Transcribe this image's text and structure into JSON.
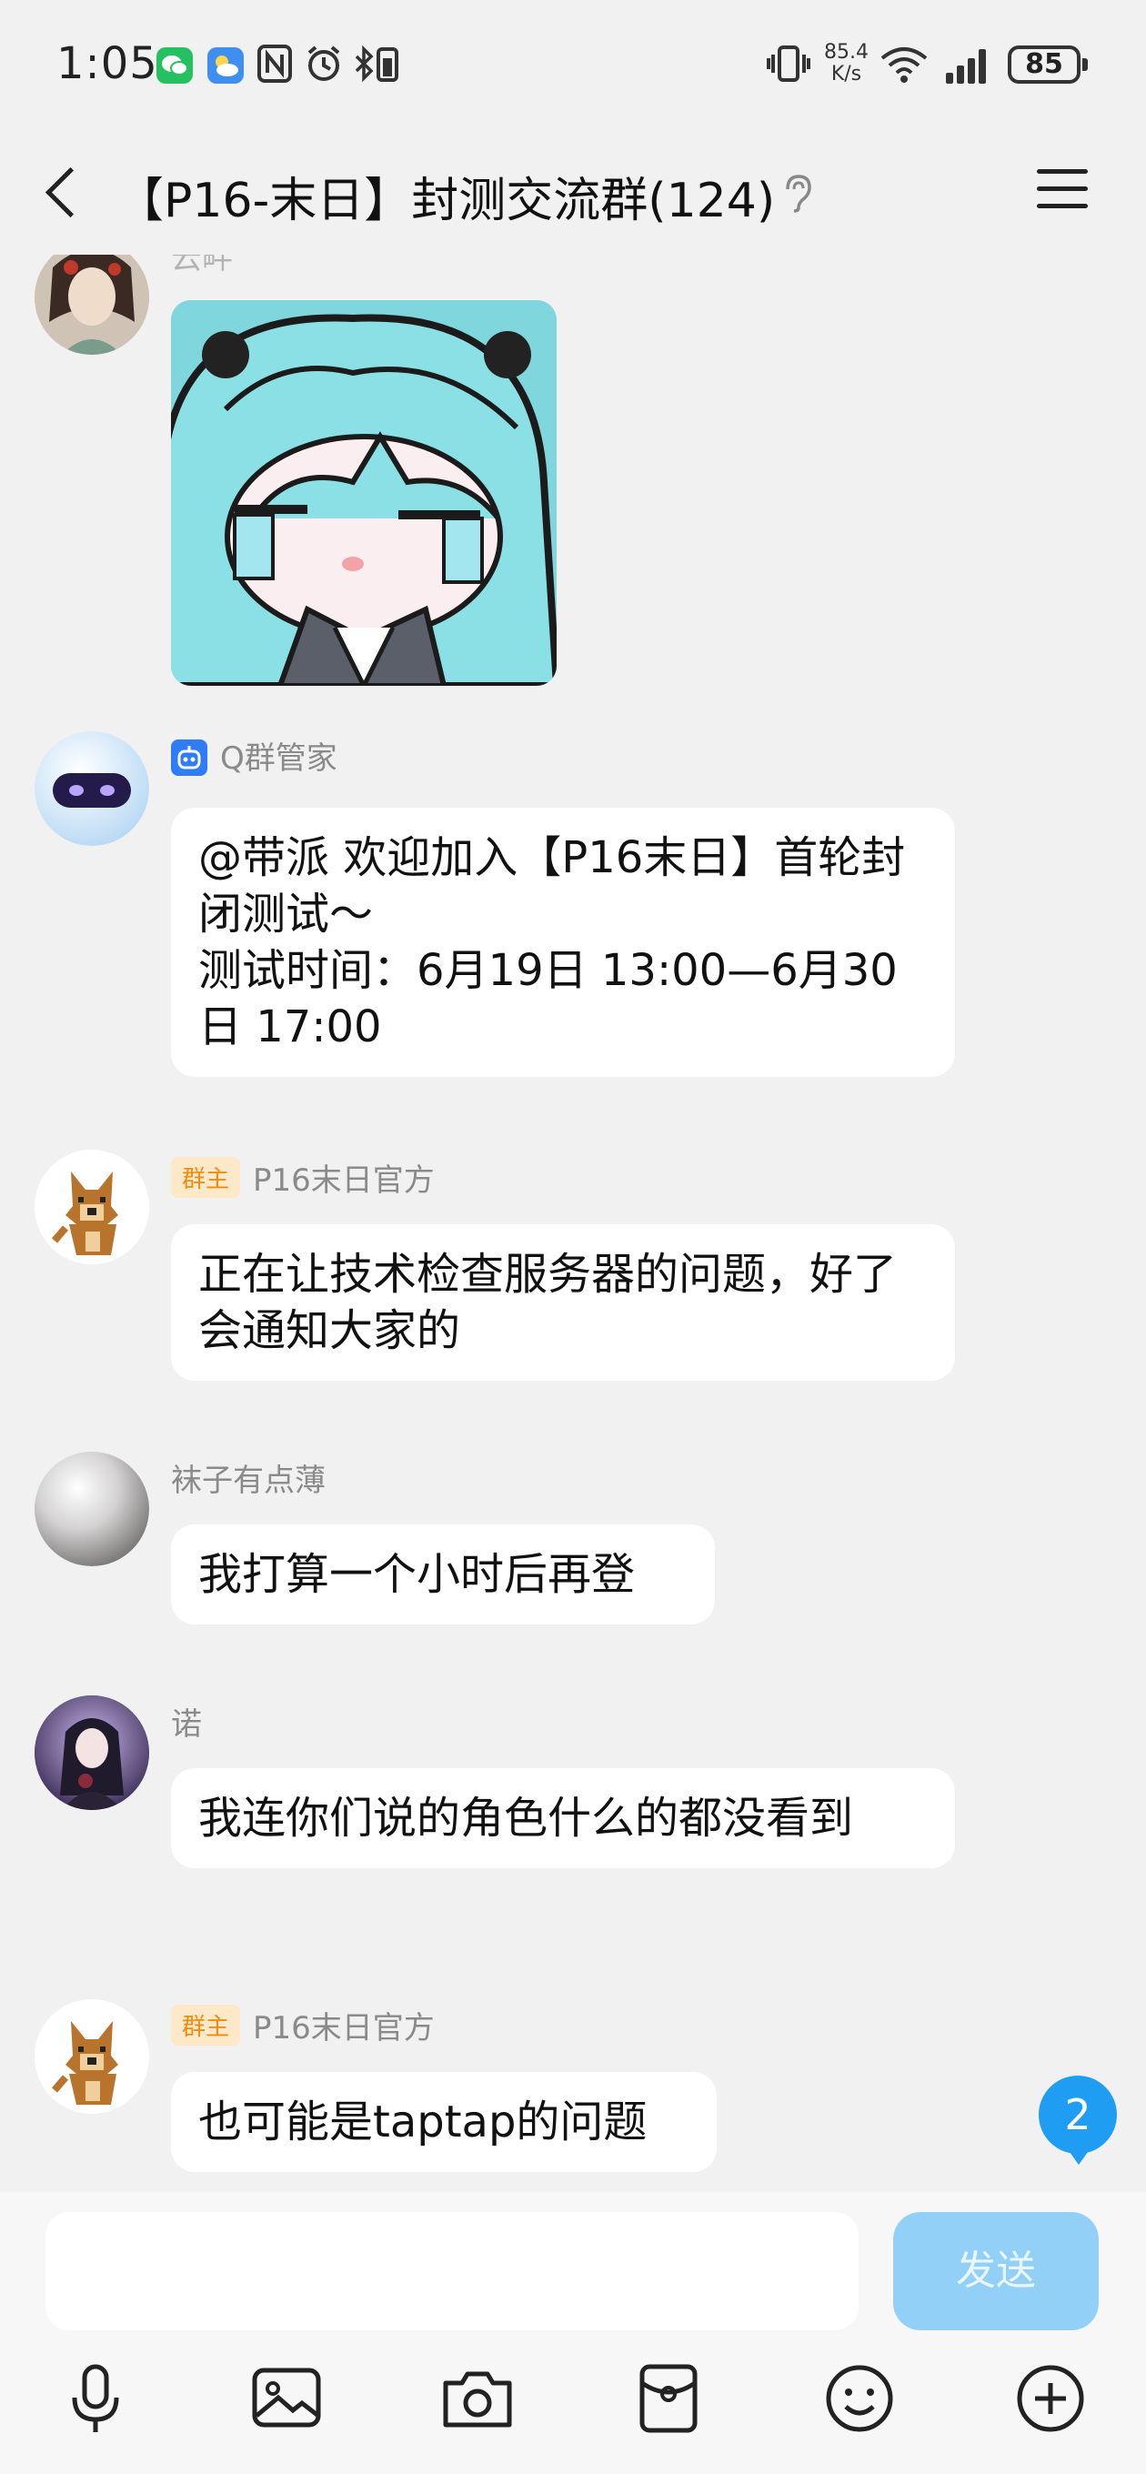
{
  "status_bar": {
    "time": "1:05",
    "net_speed_value": "85.4",
    "net_speed_unit": "K/s",
    "battery": "85"
  },
  "header": {
    "title": "【P16-末日】封测交流群(124)"
  },
  "messages": [
    {
      "sender": "云畔",
      "type": "sticker"
    },
    {
      "sender": "Q群管家",
      "text": "@带派 欢迎加入【P16末日】首轮封闭测试～\n测试时间：6月19日 13:00—6月30日 17:00"
    },
    {
      "tag": "群主",
      "sender": "P16末日官方",
      "text": "正在让技术检查服务器的问题，好了会通知大家的"
    },
    {
      "sender": "袜子有点薄",
      "text": "我打算一个小时后再登"
    },
    {
      "sender": "诺",
      "text": "我连你们说的角色什么的都没看到"
    },
    {
      "tag": "群主",
      "sender": "P16末日官方",
      "text": "也可能是taptap的问题"
    }
  ],
  "unread_count": "2",
  "composer": {
    "placeholder": "",
    "send_label": "发送"
  },
  "toolbar": [
    "microphone-icon",
    "image-icon",
    "camera-icon",
    "red-packet-icon",
    "emoji-icon",
    "plus-icon"
  ],
  "colors": {
    "background": "#f1f1f1",
    "bubble": "#ffffff",
    "accent": "#1f9df2",
    "send_disabled": "#92d0f8",
    "owner_tag": "#ef8b12"
  }
}
